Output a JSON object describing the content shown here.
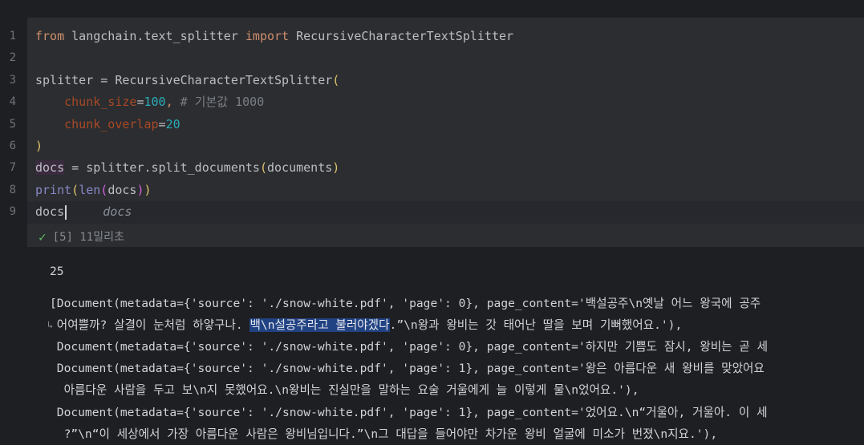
{
  "editor": {
    "line_numbers": [
      "1",
      "2",
      "3",
      "4",
      "5",
      "6",
      "7",
      "8",
      "9"
    ],
    "code": {
      "l1": {
        "kw_from": "from",
        "mod": " langchain.text_splitter ",
        "kw_import": "import",
        "name": " RecursiveCharacterTextSplitter"
      },
      "l3": {
        "lhs": "splitter = RecursiveCharacterTextSplitter",
        "paren": "("
      },
      "l4": {
        "arg": "chunk_size",
        "eq": "=",
        "val": "100",
        "comma": ",",
        "comment": " # 기본값 1000"
      },
      "l5": {
        "arg": "chunk_overlap",
        "eq": "=",
        "val": "20"
      },
      "l6": {
        "paren": ")"
      },
      "l7": {
        "var": "docs",
        "rest": " = splitter.split_documents",
        "p1": "(",
        "arg": "documents",
        "p2": ")"
      },
      "l8": {
        "fn": "print",
        "p1": "(",
        "fn2": "len",
        "p2": "(",
        "arg": "docs",
        "p3": ")",
        "p4": ")"
      },
      "l9": {
        "text": "docs",
        "ghost": "docs"
      }
    }
  },
  "status": {
    "check_icon": "check-icon",
    "text": "[5] 11밀리초"
  },
  "output": {
    "count": "25",
    "lines": [
      "[Document(metadata={'source': './snow-white.pdf', 'page': 0}, page_content='백설공주\\n옛날 어느 왕국에 공주",
      " 어여쁠까? 살결이 눈처럼 하얗구나. ",
      "백\\n설공주라고 불러야겠다",
      ".”\\n왕과 왕비는 갓 태어난 딸을 보며 기뻐했어요.'),",
      " Document(metadata={'source': './snow-white.pdf', 'page': 0}, page_content='하지만 기쁨도 잠시, 왕비는 곧 세",
      " Document(metadata={'source': './snow-white.pdf', 'page': 1}, page_content='왕은 아름다운 새 왕비를 맞았어요",
      "  아름다운 사람을 두고 보\\n지 못했어요.\\n왕비는 진실만을 말하는 요술 거울에게 늘 이렇게 물\\n었어요.'),",
      " Document(metadata={'source': './snow-white.pdf', 'page': 1}, page_content='었어요.\\n“거울아, 거울아. 이 세",
      "  ?”\\n“이 세상에서 가장 아름다운 사람은 왕비님입니다.”\\n그 대답을 들어야만 차가운 왕비 얼굴에 미소가 번졌\\n지요.'),"
    ],
    "wrap_icon": "wrap-icon"
  }
}
